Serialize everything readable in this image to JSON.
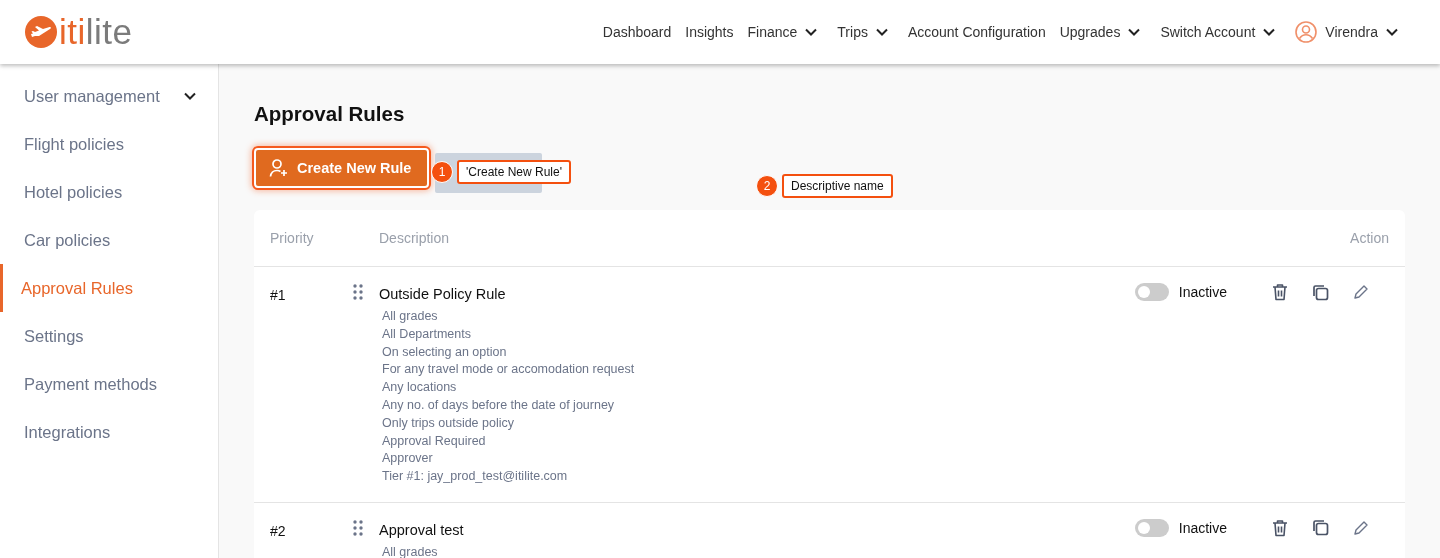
{
  "logo": {
    "text_primary": "iti",
    "text_secondary": "lite"
  },
  "nav": [
    {
      "label": "Dashboard",
      "kind": "link",
      "dropdown": false
    },
    {
      "label": "Insights",
      "kind": "link",
      "dropdown": false
    },
    {
      "label": "Finance",
      "kind": "link",
      "dropdown": true
    },
    {
      "label": "Trips",
      "kind": "link",
      "dropdown": true
    },
    {
      "label": "Account Configuration",
      "kind": "link",
      "dropdown": false
    },
    {
      "label": "Upgrades",
      "kind": "link",
      "dropdown": true
    },
    {
      "label": "Switch Account",
      "kind": "link",
      "dropdown": true
    },
    {
      "label": "Virendra",
      "kind": "user",
      "dropdown": true
    }
  ],
  "sidebar": {
    "items": [
      {
        "label": "User management",
        "selected": false,
        "dropdown": true
      },
      {
        "label": "Flight policies",
        "selected": false,
        "dropdown": false
      },
      {
        "label": "Hotel policies",
        "selected": false,
        "dropdown": false
      },
      {
        "label": "Car policies",
        "selected": false,
        "dropdown": false
      },
      {
        "label": "Approval Rules",
        "selected": true,
        "dropdown": false
      },
      {
        "label": "Settings",
        "selected": false,
        "dropdown": false
      },
      {
        "label": "Payment methods",
        "selected": false,
        "dropdown": false
      },
      {
        "label": "Integrations",
        "selected": false,
        "dropdown": false
      }
    ]
  },
  "page_title": "Approval Rules",
  "create_button": "Create New Rule",
  "annotations": [
    {
      "number": "1",
      "text": "'Create New Rule'"
    },
    {
      "number": "2",
      "text": "Descriptive name"
    }
  ],
  "table": {
    "columns": [
      "Priority",
      "Description",
      "Action"
    ],
    "rows": [
      {
        "priority": "#1",
        "name": "Outside Policy Rule",
        "active": false,
        "status": "Inactive",
        "details": [
          "All grades",
          "All Departments",
          "On selecting an option",
          "For any travel mode or accomodation request",
          "Any locations",
          "Any no. of days before the date of journey",
          "Only trips outside policy",
          "Approval Required",
          "Approver",
          "Tier #1: jay_prod_test@itilite.com"
        ]
      },
      {
        "priority": "#2",
        "name": "Approval test",
        "active": false,
        "status": "Inactive",
        "details": [
          "All grades"
        ]
      }
    ]
  }
}
